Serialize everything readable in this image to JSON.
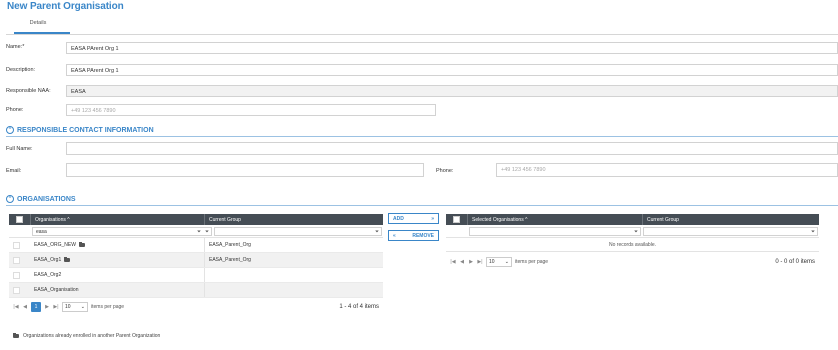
{
  "page": {
    "title": "New Parent Organisation"
  },
  "tabs": [
    {
      "label": "Details"
    }
  ],
  "details": {
    "name_label": "Name:*",
    "name_value": "EASA PArent Org 1",
    "description_label": "Description:",
    "description_value": "EASA PArent Org 1",
    "naa_label": "Responsible NAA:",
    "naa_value": "EASA",
    "phone_label": "Phone:",
    "phone_placeholder": "+49 123 456 7890"
  },
  "contact": {
    "section_title": "RESPONSIBLE CONTACT INFORMATION",
    "fullname_label": "Full Name:",
    "fullname_value": "",
    "email_label": "Email:",
    "email_value": "",
    "phone_label": "Phone:",
    "phone_placeholder": "+49 123 456 7890"
  },
  "organisations": {
    "section_title": "ORGANISATIONS",
    "left_grid": {
      "col_org": "Organisations ^",
      "col_group": "Current Group",
      "filter_value": "easa",
      "rows": [
        {
          "name": "EASA_ORG_NEW",
          "group": "EASA_Parent_Org",
          "enrolled": true
        },
        {
          "name": "EASA_Org1",
          "group": "EASA_Parent_Org",
          "enrolled": true
        },
        {
          "name": "EASA_Org2",
          "group": "",
          "enrolled": false
        },
        {
          "name": "EASA_Organisation",
          "group": "",
          "enrolled": false
        }
      ],
      "current_page": "1",
      "page_size": "10",
      "items_per_page": "items per page",
      "range": "1 - 4 of 4 items"
    },
    "add_label": "ADD",
    "remove_label": "REMOVE",
    "right_grid": {
      "col_selected": "Selected Organisations ^",
      "col_group": "Current Group",
      "empty_text": "No records available.",
      "page_size": "10",
      "items_per_page": "items per page",
      "range": "0 - 0 of 0 items"
    },
    "legend_text": "Organizations already enrolled in another Parent Organization"
  },
  "colors": {
    "accent": "#3a86c8",
    "grid_header": "#454d55"
  },
  "icons": {
    "filter": "funnel-icon",
    "enrolled": "folder-icon",
    "collapse": "chevron-up-circle-icon"
  }
}
